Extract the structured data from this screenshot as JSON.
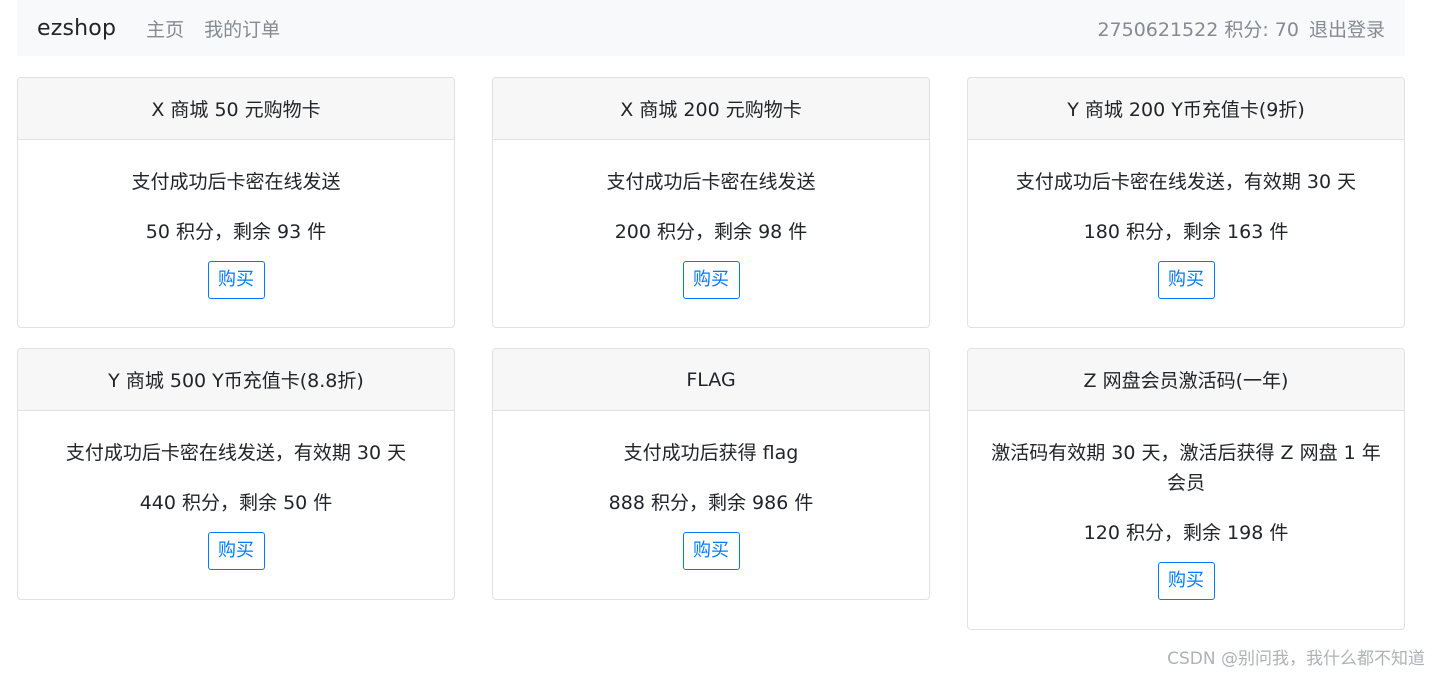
{
  "navbar": {
    "brand": "ezshop",
    "links": [
      "主页",
      "我的订单"
    ],
    "user_info": "2750621522 积分: 70",
    "logout": "退出登录"
  },
  "products": [
    {
      "title": "X 商城 50 元购物卡",
      "desc": "支付成功后卡密在线发送",
      "price": "50 积分，剩余 93 件",
      "button": "购买"
    },
    {
      "title": "X 商城 200 元购物卡",
      "desc": "支付成功后卡密在线发送",
      "price": "200 积分，剩余 98 件",
      "button": "购买"
    },
    {
      "title": "Y 商城 200 Y币充值卡(9折)",
      "desc": "支付成功后卡密在线发送，有效期 30 天",
      "price": "180 积分，剩余 163 件",
      "button": "购买"
    },
    {
      "title": "Y 商城 500 Y币充值卡(8.8折)",
      "desc": "支付成功后卡密在线发送，有效期 30 天",
      "price": "440 积分，剩余 50 件",
      "button": "购买"
    },
    {
      "title": "FLAG",
      "desc": "支付成功后获得 flag",
      "price": "888 积分，剩余 986 件",
      "button": "购买"
    },
    {
      "title": "Z 网盘会员激活码(一年)",
      "desc": "激活码有效期 30 天，激活后获得 Z 网盘 1 年会员",
      "price": "120 积分，剩余 198 件",
      "button": "购买"
    }
  ],
  "watermark": "CSDN @别问我，我什么都不知道",
  "colors": {
    "navbar_bg": "#f8f9fa",
    "card_header_bg": "#f7f7f7",
    "button_accent": "#007bff",
    "nav_link": "#858b91"
  }
}
